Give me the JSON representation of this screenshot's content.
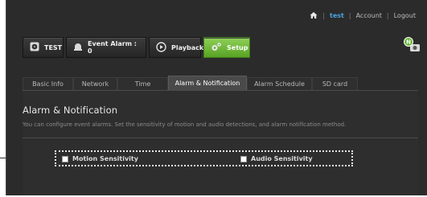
{
  "toplinks": {
    "user": "test",
    "account": "Account",
    "logout": "Logout",
    "separator": "|"
  },
  "nav": {
    "camera": "TEST",
    "event_alarm": "Event Alarm : 0",
    "playback": "Playback",
    "setup": "Setup"
  },
  "corner_badge": "N",
  "tabs": [
    "Basic Info",
    "Network",
    "Time",
    "Alarm & Notification",
    "Alarm Schedule",
    "SD card"
  ],
  "active_tab_index": 3,
  "page": {
    "title": "Alarm & Notification",
    "description": "You can configure event alarms. Set the sensitivity of motion and audio detections, and alarm notification method."
  },
  "options": {
    "motion": "Motion Sensitivity",
    "audio": "Audio Sensitivity"
  },
  "colors": {
    "accent_green": "#6cb83a",
    "user_link": "#4aa3df",
    "background": "#2b2b2b"
  }
}
